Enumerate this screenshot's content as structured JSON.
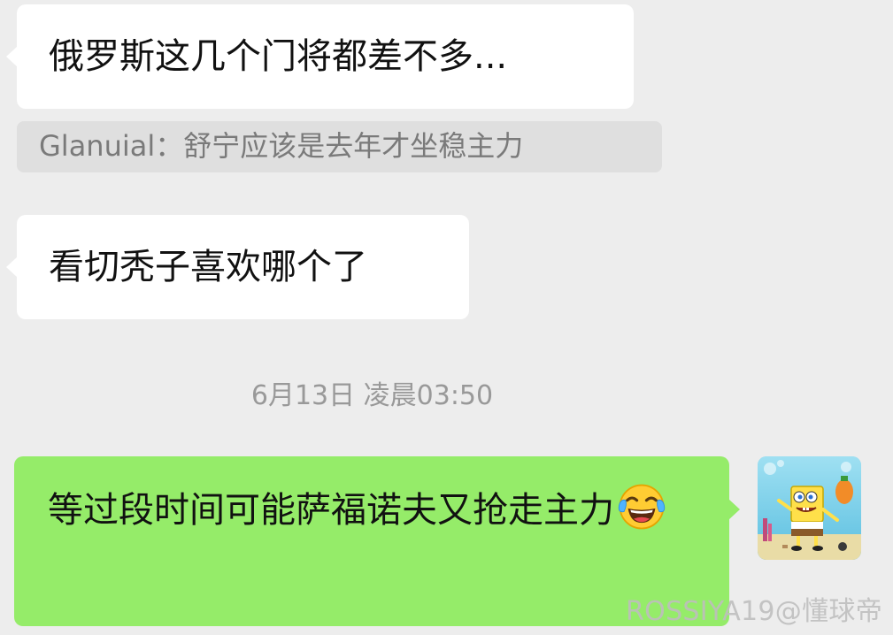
{
  "messages": [
    {
      "id": "msg1",
      "direction": "incoming",
      "text": "俄罗斯这几个门将都差不多..."
    },
    {
      "id": "quote",
      "type": "quote",
      "author": "Glanuial：",
      "text": "舒宁应该是去年才坐稳主力"
    },
    {
      "id": "msg2",
      "direction": "incoming",
      "text": "看切秃子喜欢哪个了"
    },
    {
      "id": "msg3",
      "direction": "outgoing",
      "text": "等过段时间可能萨福诺夫又抢走主力",
      "emoji": "tears-of-joy"
    }
  ],
  "timestamp": "6月13日 凌晨03:50",
  "avatar": {
    "icon": "spongebob-avatar"
  },
  "watermark": "ROSSIYA19@懂球帝",
  "colors": {
    "background": "#ededed",
    "incoming_bubble": "#ffffff",
    "outgoing_bubble": "#95ec69",
    "quote_bg": "#dfdfdf",
    "quote_text": "#7a7a7a",
    "timestamp": "#999999"
  }
}
